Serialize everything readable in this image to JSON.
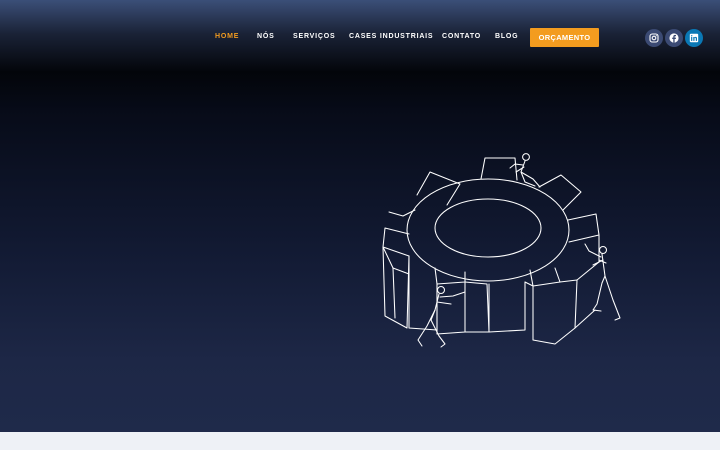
{
  "nav": {
    "items": [
      {
        "label": "HOME",
        "active": true
      },
      {
        "label": "NÓS",
        "active": false
      },
      {
        "label": "SERVIÇOS",
        "active": false
      },
      {
        "label": "CASES INDUSTRIAIS",
        "active": false
      },
      {
        "label": "CONTATO",
        "active": false
      },
      {
        "label": "BLOG",
        "active": false
      }
    ],
    "cta_label": "ORÇAMENTO"
  },
  "social": {
    "icons": [
      "instagram-icon",
      "facebook-icon",
      "linkedin-icon"
    ]
  },
  "hero": {
    "illustration": "gear-teamwork-line-art"
  },
  "colors": {
    "accent": "#f39c1f",
    "nav_text": "#ffffff",
    "hero_dark": "#03050a",
    "hero_bottom": "#1f2a4a",
    "linkedin": "#0a78b5",
    "social_bg": "#3b4a73",
    "page_bg": "#eef1f6"
  }
}
